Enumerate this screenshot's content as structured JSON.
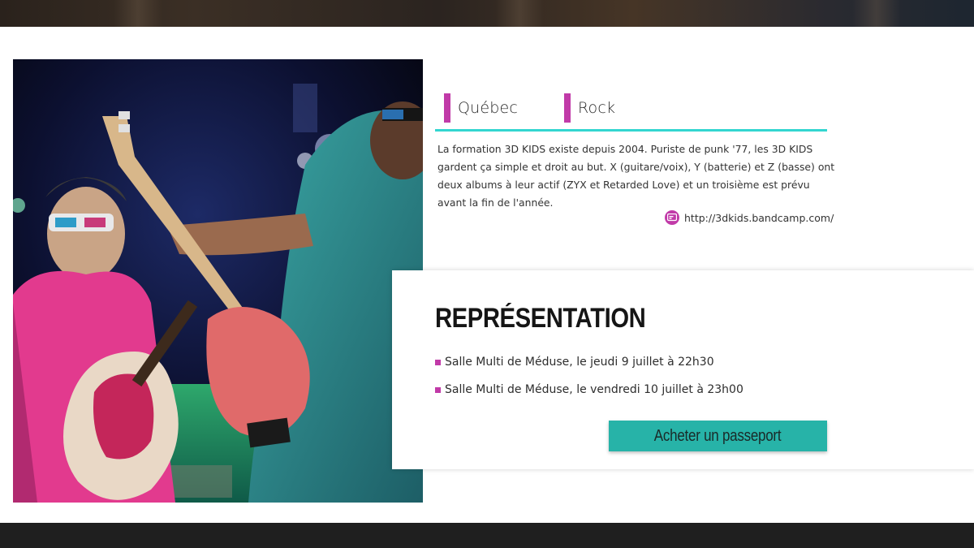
{
  "tags": [
    {
      "label": "Québec"
    },
    {
      "label": "Rock"
    }
  ],
  "description": "La formation 3D KIDS existe depuis 2004. Puriste de punk '77, les 3D KIDS gardent ça simple et droit au but. X (guitare/voix), Y (batterie) et Z (basse) ont deux albums à leur actif (ZYX et Retarded Love) et un troisième est prévu avant la fin de l'année.",
  "website": {
    "url_text": "http://3dkids.bandcamp.com/",
    "icon": "globe-icon"
  },
  "representation": {
    "title": "REPRÉSENTATION",
    "shows": [
      "Salle Multi de Méduse, le jeudi 9 juillet à 22h30",
      "Salle Multi de Méduse, le vendredi 10 juillet à 23h00"
    ],
    "buy_label": "Acheter un passeport"
  },
  "colors": {
    "accent_magenta": "#c13aa8",
    "accent_teal": "#33d6d0",
    "button_teal": "#27b3a8",
    "footer": "#1f1f1f"
  }
}
